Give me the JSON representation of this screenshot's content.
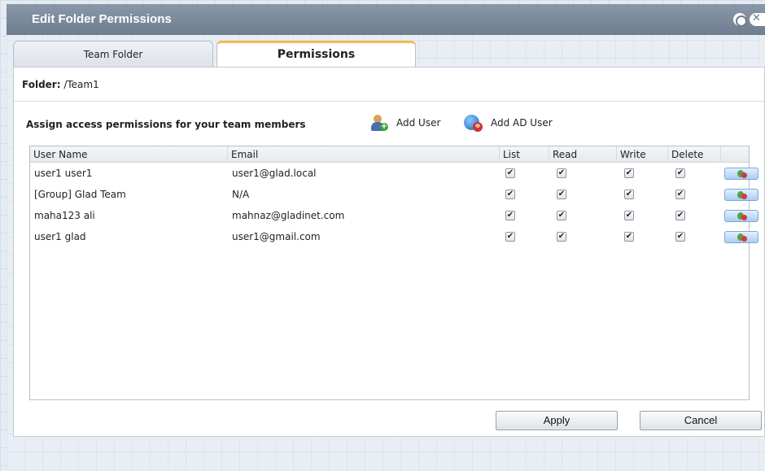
{
  "window": {
    "title": "Edit Folder Permissions"
  },
  "tabs": [
    {
      "label": "Team Folder",
      "active": false
    },
    {
      "label": "Permissions",
      "active": true
    }
  ],
  "folder": {
    "label": "Folder:",
    "path": "/Team1"
  },
  "assign": {
    "text": "Assign access permissions for your team members",
    "add_user_label": "Add User",
    "add_ad_user_label": "Add AD User"
  },
  "table": {
    "columns": [
      "User Name",
      "Email",
      "List",
      "Read",
      "Write",
      "Delete",
      ""
    ],
    "rows": [
      {
        "user": "user1 user1",
        "email": "user1@glad.local",
        "list": true,
        "read": true,
        "write": true,
        "delete": true
      },
      {
        "user": "[Group] Glad Team",
        "email": "N/A",
        "list": true,
        "read": true,
        "write": true,
        "delete": true
      },
      {
        "user": "maha123 ali",
        "email": "mahnaz@gladinet.com",
        "list": true,
        "read": true,
        "write": true,
        "delete": true
      },
      {
        "user": "user1 glad",
        "email": "user1@gmail.com",
        "list": true,
        "read": true,
        "write": true,
        "delete": true
      }
    ]
  },
  "buttons": {
    "apply": "Apply",
    "cancel": "Cancel"
  },
  "icons": {
    "title_buttons": [
      "minimize-icon",
      "close-icon"
    ],
    "add_user": "add-user-icon",
    "add_ad_user": "add-ad-user-icon",
    "row_action": "remove-user-icon"
  },
  "colors": {
    "titlebar": "#7b8a9c",
    "active_tab_accent": "#f5b94e",
    "row_button": "#a9cdf3"
  }
}
